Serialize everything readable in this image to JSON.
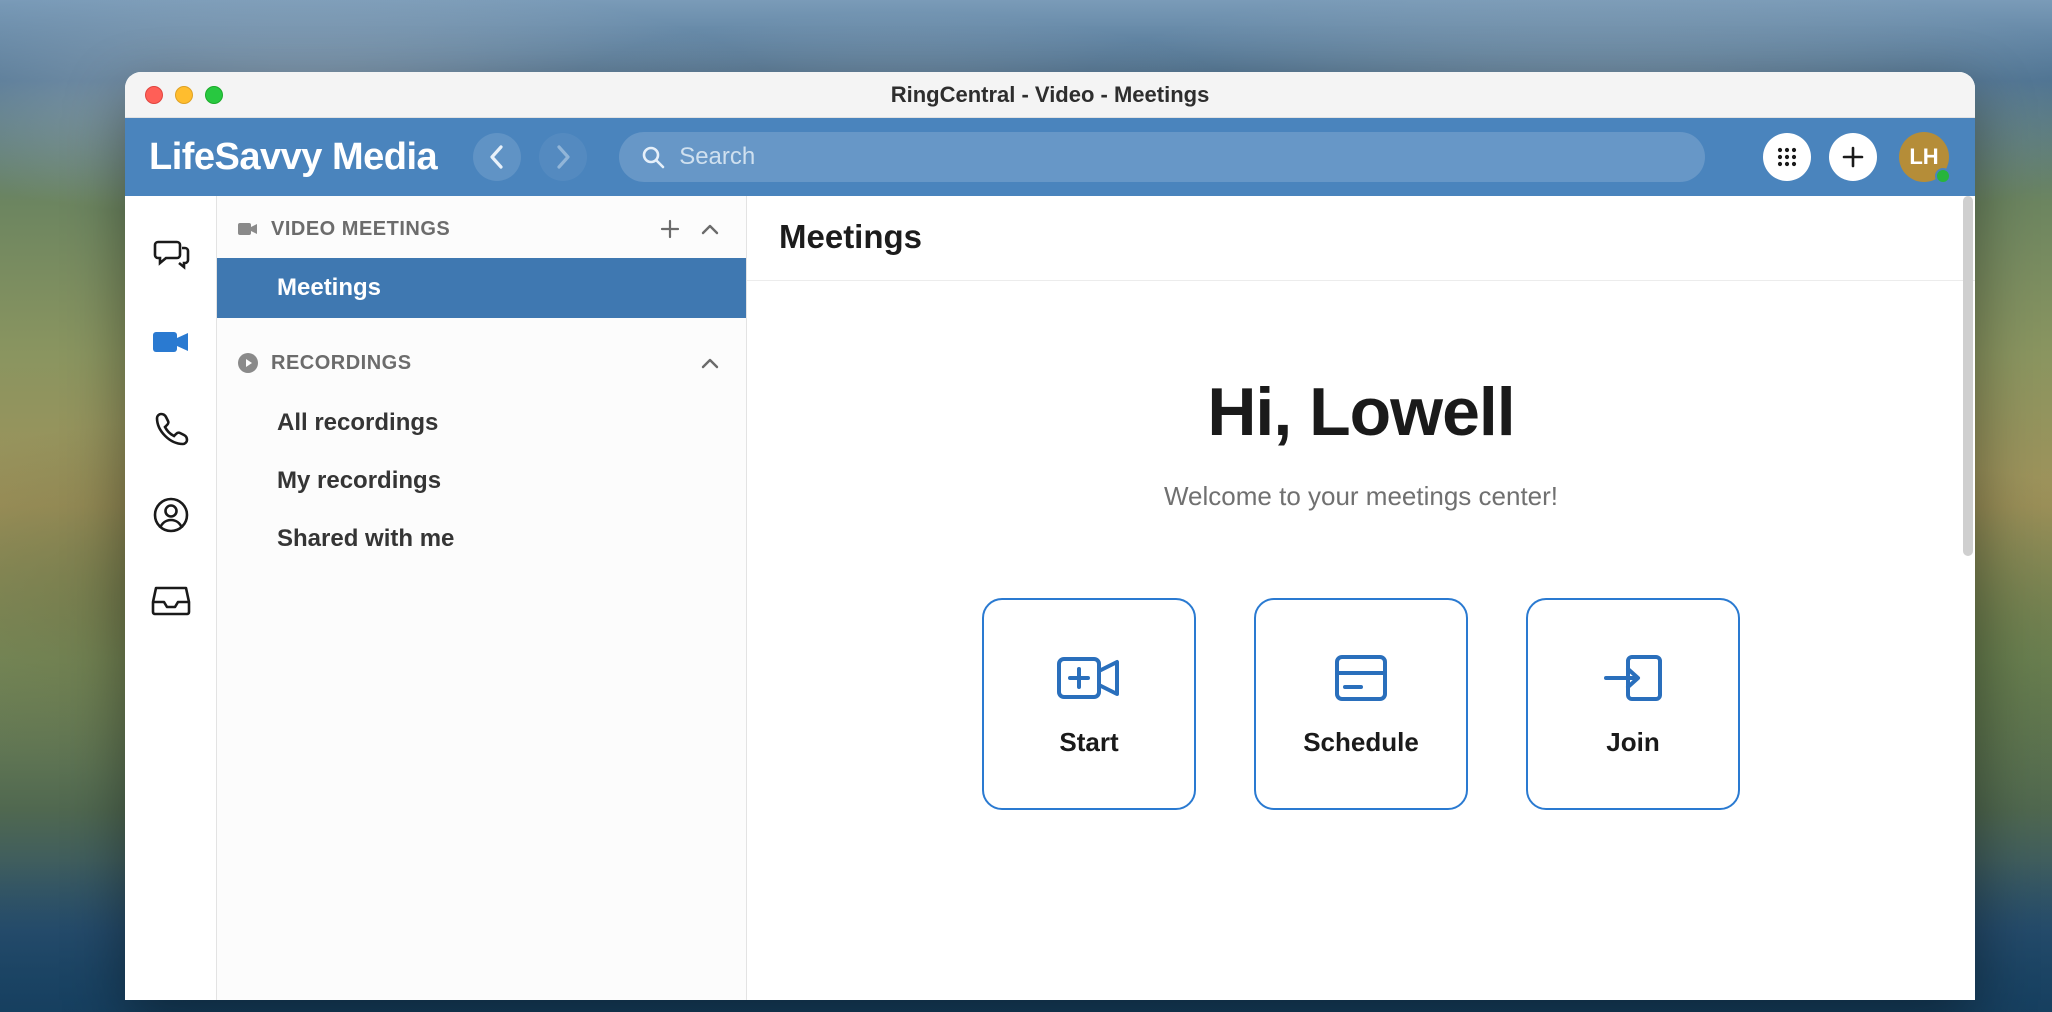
{
  "window": {
    "title": "RingCentral - Video - Meetings"
  },
  "topbar": {
    "brand": "LifeSavvy Media",
    "search_placeholder": "Search",
    "avatar_initials": "LH"
  },
  "sidepanel": {
    "section_video_label": "VIDEO MEETINGS",
    "meetings_label": "Meetings",
    "section_recordings_label": "RECORDINGS",
    "recordings_items": [
      {
        "label": "All recordings"
      },
      {
        "label": "My recordings"
      },
      {
        "label": "Shared with me"
      }
    ]
  },
  "main": {
    "title": "Meetings",
    "greeting": "Hi, Lowell",
    "welcome": "Welcome to your meetings center!",
    "actions": {
      "start": "Start",
      "schedule": "Schedule",
      "join": "Join"
    }
  }
}
